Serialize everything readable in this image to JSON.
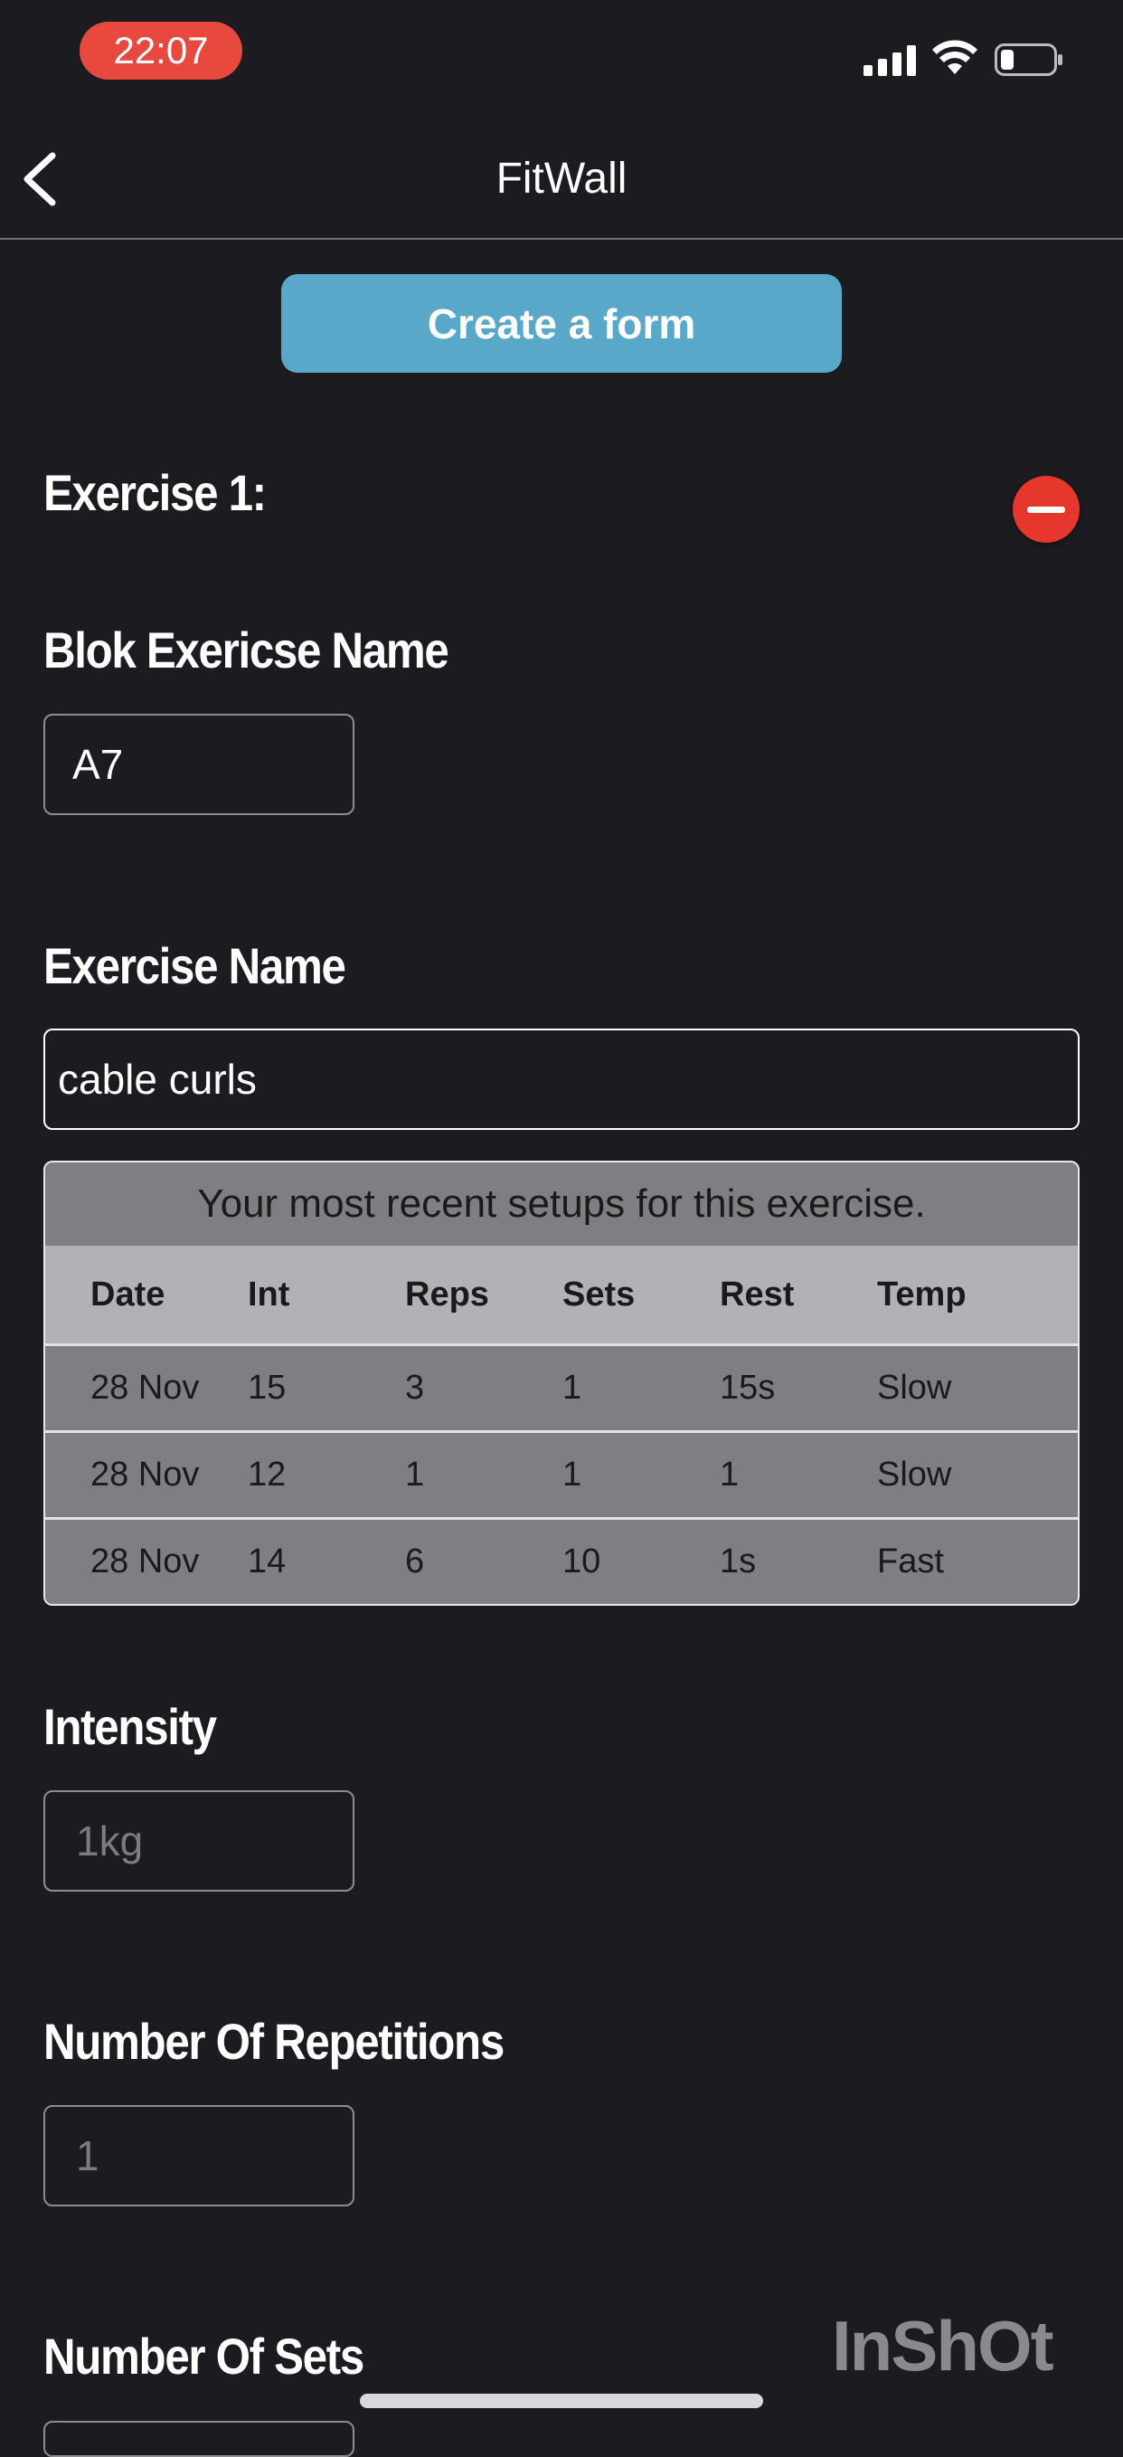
{
  "status_bar": {
    "time": "22:07"
  },
  "nav": {
    "title": "FitWall"
  },
  "create_button": {
    "label": "Create a form"
  },
  "exercise": {
    "heading": "Exercise 1:",
    "blok_label": "Blok Exericse Name",
    "blok_value": "A7",
    "name_label": "Exercise Name",
    "name_value": "cable curls"
  },
  "recent": {
    "caption": "Your most recent setups for this exercise.",
    "columns": [
      "Date",
      "Int",
      "Reps",
      "Sets",
      "Rest",
      "Temp"
    ],
    "rows": [
      [
        "28 Nov",
        "15",
        "3",
        "1",
        "15s",
        "Slow"
      ],
      [
        "28 Nov",
        "12",
        "1",
        "1",
        "1",
        "Slow"
      ],
      [
        "28 Nov",
        "14",
        "6",
        "10",
        "1s",
        "Fast"
      ]
    ]
  },
  "intensity": {
    "label": "Intensity",
    "placeholder": "1kg"
  },
  "repetitions": {
    "label": "Number Of Repetitions",
    "placeholder": "1"
  },
  "sets": {
    "label": "Number Of Sets"
  },
  "watermark": "InShOt",
  "colors": {
    "accent": "#5aa8c9",
    "danger": "#e5372c",
    "background": "#1c1b1f"
  }
}
